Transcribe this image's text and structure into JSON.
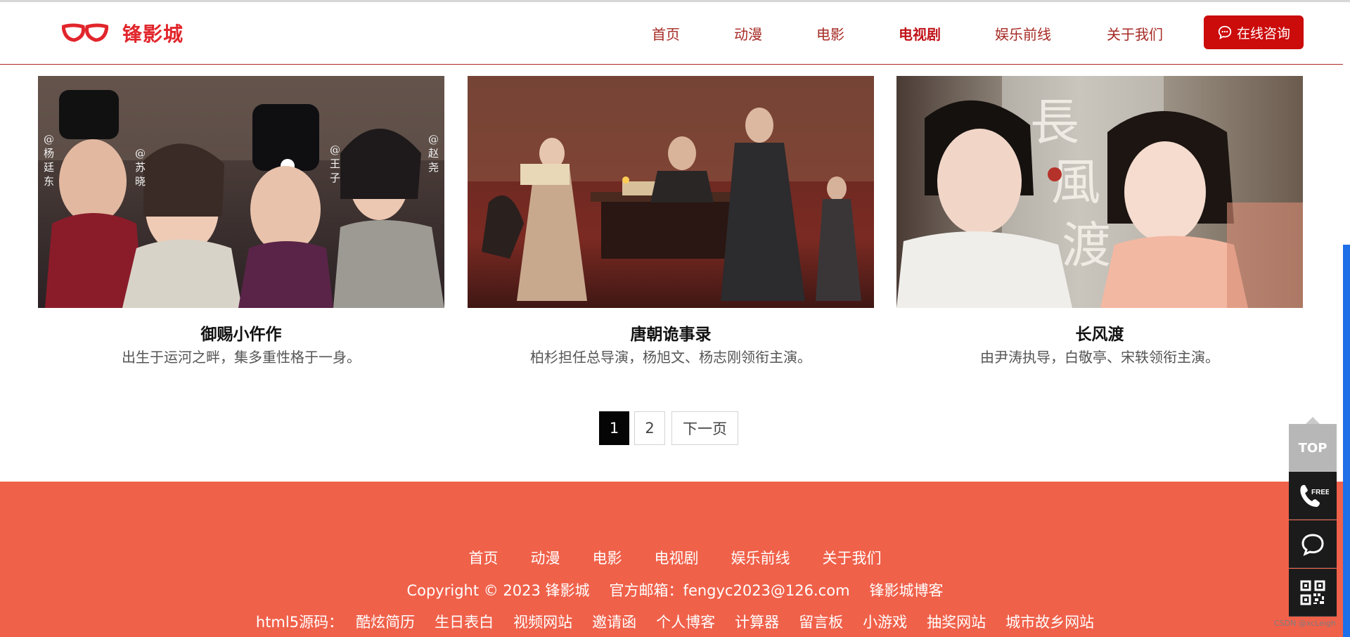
{
  "brand": {
    "name": "锋影城",
    "color": "#e1262c"
  },
  "nav": {
    "items": [
      {
        "label": "首页",
        "active": false
      },
      {
        "label": "动漫",
        "active": false
      },
      {
        "label": "电影",
        "active": false
      },
      {
        "label": "电视剧",
        "active": true
      },
      {
        "label": "娱乐前线",
        "active": false
      },
      {
        "label": "关于我们",
        "active": false
      }
    ],
    "consult_label": "在线咨询",
    "consult_icon": "chat-bubble-icon"
  },
  "cards": [
    {
      "title": "御赐小仵作",
      "desc": "出生于运河之畔，集多重性格于一身。"
    },
    {
      "title": "唐朝诡事录",
      "desc": "柏杉担任总导演，杨旭文、杨志刚领衔主演。"
    },
    {
      "title": "长风渡",
      "desc": "由尹涛执导，白敬亭、宋轶领衔主演。"
    }
  ],
  "pagination": {
    "current": "1",
    "pages": [
      "2"
    ],
    "next_label": "下一页"
  },
  "footer": {
    "nav": [
      "首页",
      "动漫",
      "电影",
      "电视剧",
      "娱乐前线",
      "关于我们"
    ],
    "copyright": "Copyright © 2023 锋影城",
    "email": "官方邮箱：fengyc2023@126.com",
    "blog": "锋影城博客",
    "links_label": "html5源码：",
    "links": [
      "酷炫简历",
      "生日表白",
      "视频网站",
      "邀请函",
      "个人博客",
      "计算器",
      "留言板",
      "小游戏",
      "抽奖网站",
      "城市故乡网站"
    ],
    "bg_color": "#f0614a"
  },
  "side_toolbar": {
    "top_label": "TOP",
    "phone_badge": "FREE",
    "icons": [
      "phone-free-icon",
      "chat-icon",
      "qr-code-icon"
    ]
  },
  "watermark": "CSDN @xcLeigh"
}
